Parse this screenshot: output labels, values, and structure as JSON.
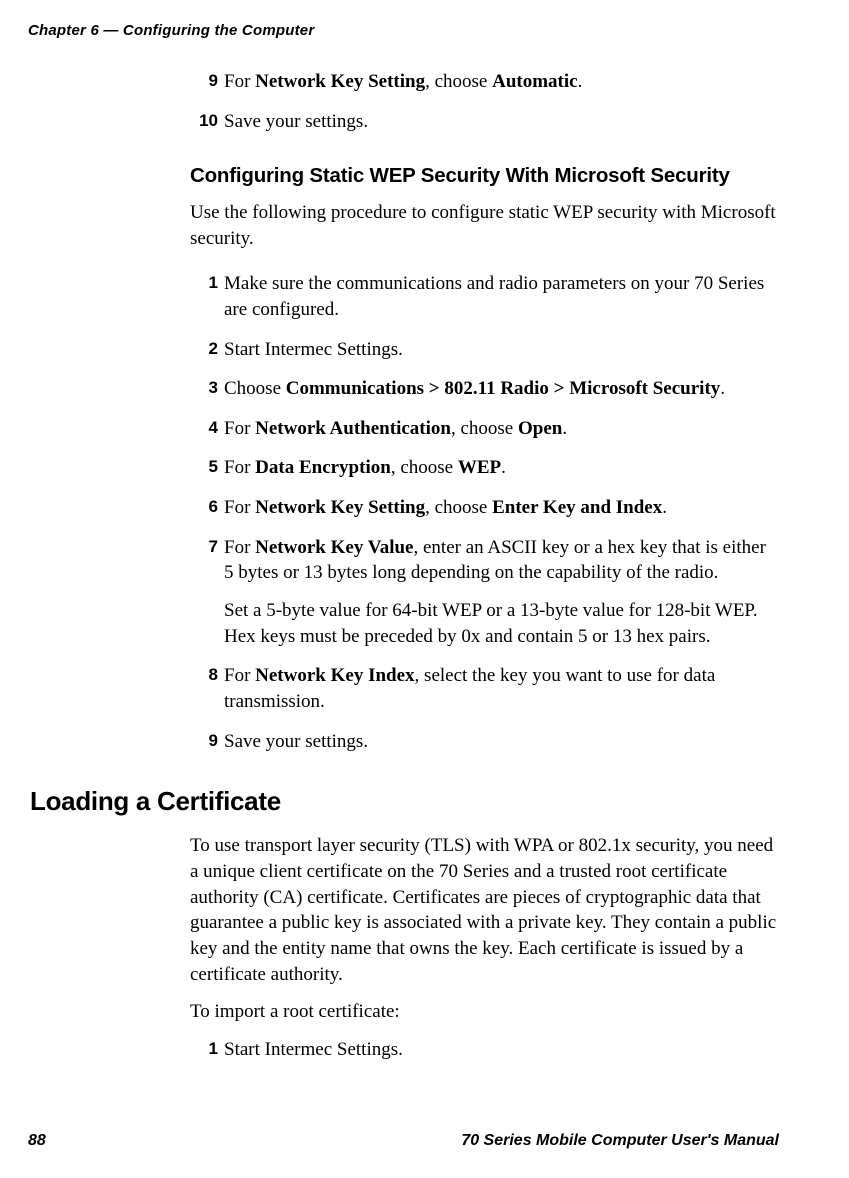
{
  "header": "Chapter 6 — Configuring the Computer",
  "preSteps": [
    {
      "n": "9",
      "parts": [
        {
          "t": "For ",
          "b": false
        },
        {
          "t": "Network Key Setting",
          "b": true
        },
        {
          "t": ", choose ",
          "b": false
        },
        {
          "t": "Automatic",
          "b": true
        },
        {
          "t": ".",
          "b": false
        }
      ]
    },
    {
      "n": "10",
      "parts": [
        {
          "t": "Save your settings.",
          "b": false
        }
      ]
    }
  ],
  "subheading": "Configuring Static WEP Security With Microsoft Security",
  "intro": "Use the following procedure to configure static WEP security with Microsoft security.",
  "steps": [
    {
      "n": "1",
      "parts": [
        {
          "t": "Make sure the communications and radio parameters on your 70 Series are configured.",
          "b": false
        }
      ]
    },
    {
      "n": "2",
      "parts": [
        {
          "t": "Start Intermec Settings.",
          "b": false
        }
      ]
    },
    {
      "n": "3",
      "parts": [
        {
          "t": "Choose ",
          "b": false
        },
        {
          "t": "Communications > 802.11 Radio > Microsoft Security",
          "b": true
        },
        {
          "t": ".",
          "b": false
        }
      ]
    },
    {
      "n": "4",
      "parts": [
        {
          "t": "For ",
          "b": false
        },
        {
          "t": "Network Authentication",
          "b": true
        },
        {
          "t": ", choose ",
          "b": false
        },
        {
          "t": "Open",
          "b": true
        },
        {
          "t": ".",
          "b": false
        }
      ]
    },
    {
      "n": "5",
      "parts": [
        {
          "t": "For ",
          "b": false
        },
        {
          "t": "Data Encryption",
          "b": true
        },
        {
          "t": ", choose ",
          "b": false
        },
        {
          "t": "WEP",
          "b": true
        },
        {
          "t": ".",
          "b": false
        }
      ]
    },
    {
      "n": "6",
      "parts": [
        {
          "t": "For ",
          "b": false
        },
        {
          "t": "Network Key Setting",
          "b": true
        },
        {
          "t": ", choose ",
          "b": false
        },
        {
          "t": "Enter Key and Index",
          "b": true
        },
        {
          "t": ".",
          "b": false
        }
      ]
    },
    {
      "n": "7",
      "parts": [
        {
          "t": "For ",
          "b": false
        },
        {
          "t": "Network Key Value",
          "b": true
        },
        {
          "t": ", enter an ASCII key or a hex key that is either 5 bytes or 13 bytes long depending on the capability of the radio.",
          "b": false
        }
      ],
      "sub": "Set a 5-byte value for 64-bit WEP or a 13-byte value for 128-bit WEP. Hex keys must be preceded by 0x and contain 5 or 13 hex pairs."
    },
    {
      "n": "8",
      "parts": [
        {
          "t": "For ",
          "b": false
        },
        {
          "t": "Network Key Index",
          "b": true
        },
        {
          "t": ", select the key you want to use for data transmission.",
          "b": false
        }
      ]
    },
    {
      "n": "9",
      "parts": [
        {
          "t": "Save your settings.",
          "b": false
        }
      ]
    }
  ],
  "mainheading": "Loading a Certificate",
  "certPara": "To use transport layer security (TLS) with WPA or 802.1x security, you need a unique client certificate on the 70 Series and a trusted root certificate authority (CA) certificate. Certificates are pieces of cryptographic data that guarantee a public key is associated with a private key. They contain a public key and the entity name that owns the key. Each certificate is issued by a certificate authority.",
  "certImport": "To import a root certificate:",
  "certSteps": [
    {
      "n": "1",
      "parts": [
        {
          "t": "Start Intermec Settings.",
          "b": false
        }
      ]
    }
  ],
  "footer": {
    "pageNum": "88",
    "title": "70 Series Mobile Computer User's Manual"
  }
}
